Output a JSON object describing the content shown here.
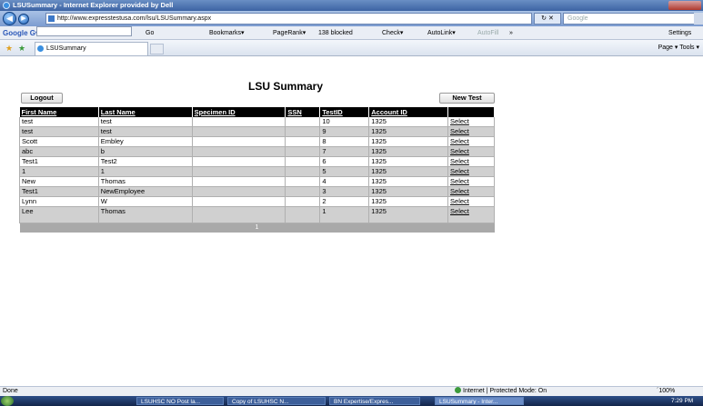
{
  "window": {
    "title": "LSUSummary - Internet Explorer provided by Dell"
  },
  "address": {
    "url": "http://www.expresstestusa.com/lsu/LSUSummary.aspx",
    "search_placeholder": "Google"
  },
  "google_toolbar": {
    "logo": "Google G▾",
    "go": "Go",
    "bookmarks": "Bookmarks▾",
    "pagerank": "PageRank▾",
    "blocked": "138 blocked",
    "check": "Check▾",
    "autolink": "AutoLink▾",
    "autofill": "AutoFill",
    "more": "»",
    "settings": "Settings"
  },
  "tabs": {
    "active_tab": "LSUSummary",
    "commands": "Page ▾  Tools ▾"
  },
  "page": {
    "title": "LSU Summary",
    "logout_label": "Logout",
    "newtest_label": "New Test",
    "columns": [
      "First Name",
      "Last Name",
      "Specimen ID",
      "SSN",
      "TestID",
      "Account ID",
      ""
    ],
    "rows": [
      {
        "first": "test",
        "last": "test",
        "specimen": "",
        "ssn": "",
        "testid": "10",
        "account": "1325",
        "action": "Select"
      },
      {
        "first": "test",
        "last": "test",
        "specimen": "",
        "ssn": "",
        "testid": "9",
        "account": "1325",
        "action": "Select"
      },
      {
        "first": "Scott",
        "last": "Embley",
        "specimen": "",
        "ssn": "",
        "testid": "8",
        "account": "1325",
        "action": "Select"
      },
      {
        "first": "abc",
        "last": "b",
        "specimen": "",
        "ssn": "",
        "testid": "7",
        "account": "1325",
        "action": "Select"
      },
      {
        "first": "Test1",
        "last": "Test2",
        "specimen": "",
        "ssn": "",
        "testid": "6",
        "account": "1325",
        "action": "Select"
      },
      {
        "first": "1",
        "last": "1",
        "specimen": "",
        "ssn": "",
        "testid": "5",
        "account": "1325",
        "action": "Select"
      },
      {
        "first": "New",
        "last": "Thomas",
        "specimen": "",
        "ssn": "",
        "testid": "4",
        "account": "1325",
        "action": "Select"
      },
      {
        "first": "Test1",
        "last": "NewEmployee",
        "specimen": "",
        "ssn": "",
        "testid": "3",
        "account": "1325",
        "action": "Select"
      },
      {
        "first": "Lynn",
        "last": "W",
        "specimen": "",
        "ssn": "",
        "testid": "2",
        "account": "1325",
        "action": "Select"
      },
      {
        "first": "Lee",
        "last": "Thomas",
        "specimen": "",
        "ssn": "",
        "testid": "1",
        "account": "1325",
        "action": "Select"
      }
    ],
    "pager": "1"
  },
  "status": {
    "left": "Done",
    "zone": "Internet | Protected Mode: On",
    "zoom": "´100%"
  },
  "taskbar": {
    "items": [
      "LSUHSC NO Post la...",
      "Copy of LSUHSC N...",
      "BN Expertise/Expres...",
      "LSUSummary - Inter..."
    ],
    "clock": "7:29 PM"
  }
}
